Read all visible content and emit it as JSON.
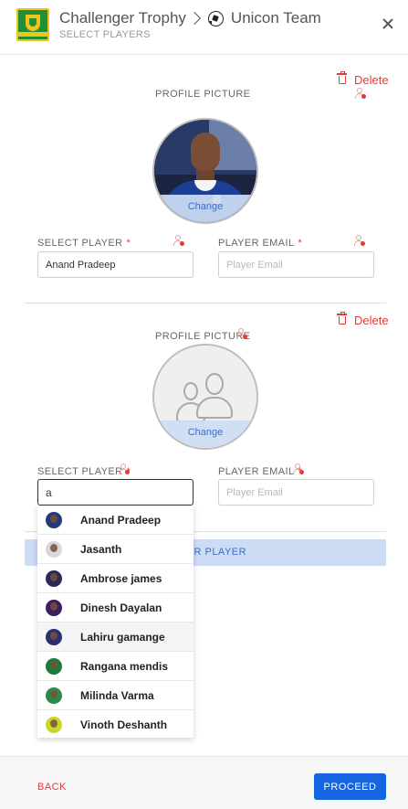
{
  "header": {
    "tournament": "Challenger Trophy",
    "team": "Unicon Team",
    "subtitle": "SELECT PLAYERS"
  },
  "slot1": {
    "delete_label": "Delete",
    "profile_label": "PROFILE PICTURE",
    "change_label": "Change",
    "select_player_label": "SELECT PLAYER",
    "player_value": "Anand Pradeep",
    "email_label": "PLAYER EMAIL",
    "email_placeholder": "Player Email",
    "required_mark": "*"
  },
  "slot2": {
    "delete_label": "Delete",
    "profile_label": "PROFILE PICTURE",
    "change_label": "Change",
    "select_player_label": "SELECT PLAYER",
    "player_value": "a",
    "email_label": "PLAYER EMAIL",
    "email_placeholder": "Player Email",
    "required_mark": "*"
  },
  "add_player_label": "OTHER PLAYER",
  "dropdown": {
    "options": [
      {
        "name": "Anand Pradeep",
        "color": "#243a7a"
      },
      {
        "name": "Jasanth",
        "color": "#d8d8d8"
      },
      {
        "name": "Ambrose james",
        "color": "#2a2a55"
      },
      {
        "name": "Dinesh Dayalan",
        "color": "#3a1f5c"
      },
      {
        "name": "Lahiru gamange",
        "color": "#28306e"
      },
      {
        "name": "Rangana mendis",
        "color": "#1e7a3a"
      },
      {
        "name": "Milinda Varma",
        "color": "#2f8a4a"
      },
      {
        "name": "Vinoth Deshanth",
        "color": "#c9d62a"
      }
    ]
  },
  "footer": {
    "back_label": "BACK",
    "proceed_label": "PROCEED"
  },
  "colors": {
    "accent": "#1565e0",
    "danger": "#e53935",
    "add_button_bg": "#cddcf5"
  }
}
